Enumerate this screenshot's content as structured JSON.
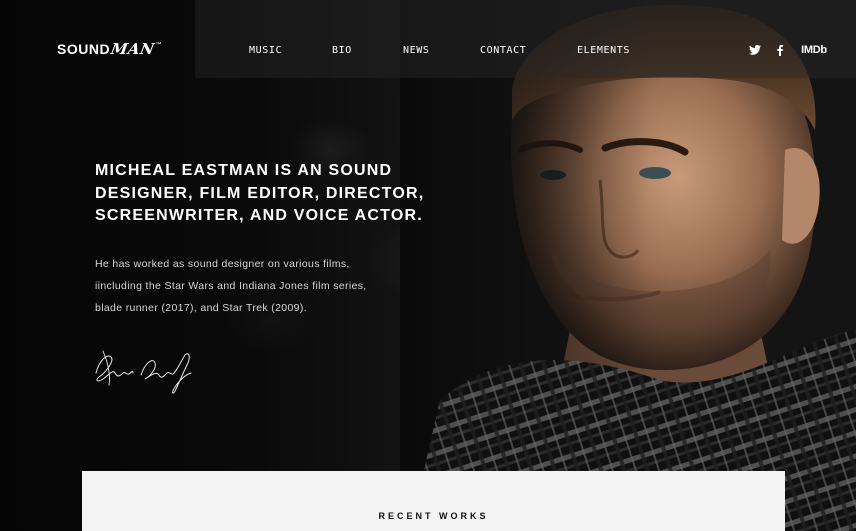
{
  "header": {
    "logo": {
      "sound": "SOUND",
      "man": "MAN",
      "tm": "™"
    },
    "nav": [
      {
        "label": "MUSIC"
      },
      {
        "label": "BIO"
      },
      {
        "label": "NEWS"
      },
      {
        "label": "CONTACT"
      },
      {
        "label": "ELEMENTS"
      }
    ],
    "social": {
      "twitter": "twitter-icon",
      "facebook": "facebook-icon",
      "imdb_label": "IMDb"
    }
  },
  "hero": {
    "headline": "MICHEAL EASTMAN IS AN SOUND DESIGNER, FILM EDITOR, DIRECTOR, SCREENWRITER, AND VOICE ACTOR.",
    "bio_lines": [
      "He has worked as sound designer on various films,",
      "iincluding the Star Wars and Indiana Jones film series,",
      "blade runner (2017), and Star Trek (2009)."
    ],
    "signature": "signature-image"
  },
  "recent_works": {
    "title": "RECENT WORKS"
  },
  "colors": {
    "background": "#080808",
    "text_primary": "#ffffff",
    "text_body": "#d6d6d6",
    "panel": "#f3f3f3",
    "panel_text": "#111111"
  }
}
